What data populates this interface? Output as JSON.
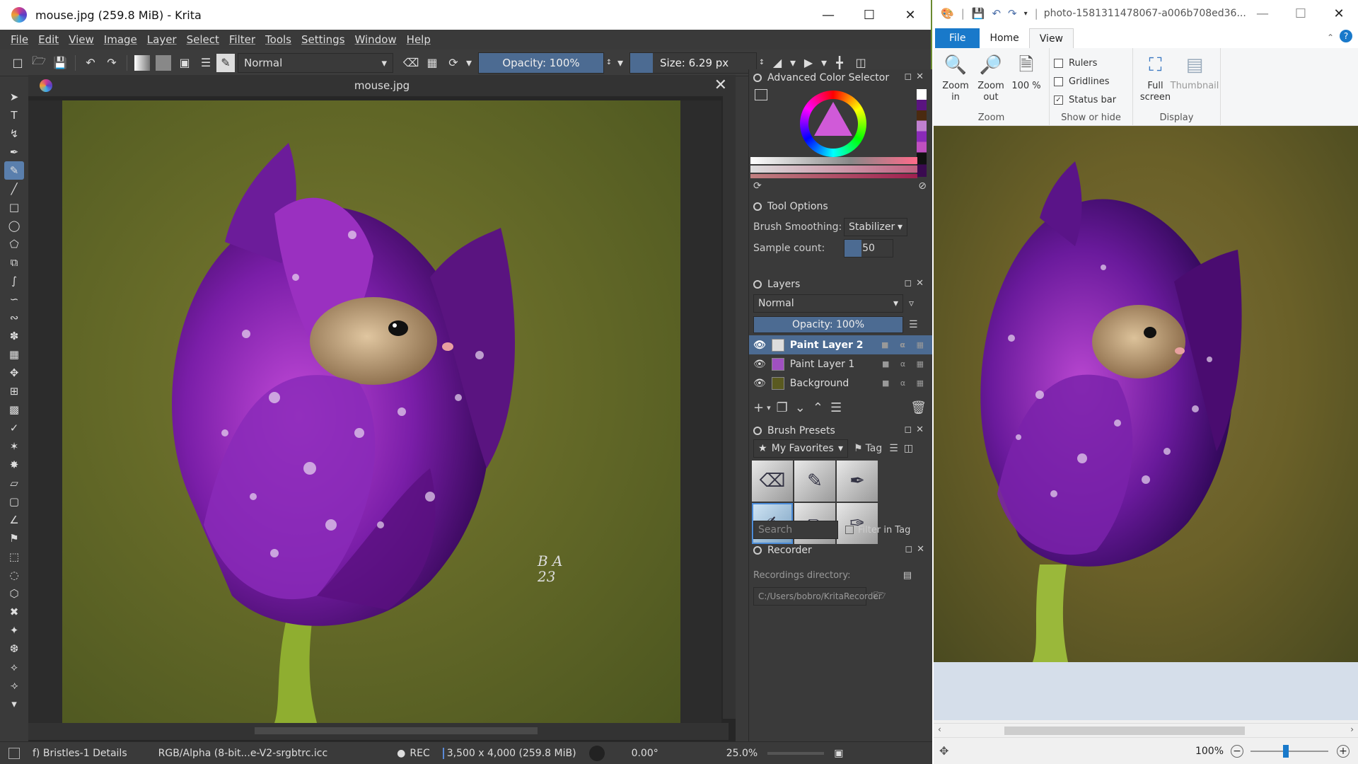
{
  "krita": {
    "window_title": "mouse.jpg (259.8 MiB)  - Krita",
    "menu": [
      "File",
      "Edit",
      "View",
      "Image",
      "Layer",
      "Select",
      "Filter",
      "Tools",
      "Settings",
      "Window",
      "Help"
    ],
    "toolbar": {
      "blend_mode": "Normal",
      "opacity": "Opacity: 100%",
      "size": "Size: 6.29 px"
    },
    "document_tab": "mouse.jpg",
    "canvas_signature": "B A\n23",
    "dockers": {
      "color_selector": {
        "title": "Advanced Color Selector"
      },
      "tool_options": {
        "title": "Tool Options",
        "smoothing_label": "Brush Smoothing:",
        "smoothing_value": "Stabilizer",
        "sample_label": "Sample count:",
        "sample_value": "50"
      },
      "layers": {
        "title": "Layers",
        "blend": "Normal",
        "opacity": "Opacity:  100%",
        "items": [
          {
            "name": "Paint Layer 2",
            "selected": true
          },
          {
            "name": "Paint Layer 1",
            "selected": false
          },
          {
            "name": "Background",
            "selected": false
          }
        ]
      },
      "brush_presets": {
        "title": "Brush Presets",
        "filter": "My Favorites",
        "tag": "Tag",
        "search_placeholder": "Search",
        "filter_in_tag": "Filter in Tag"
      },
      "recorder": {
        "title": "Recorder",
        "dir_label": "Recordings directory:",
        "dir_value": "C:/Users/bobro/KritaRecorder"
      }
    },
    "status": {
      "brush": "f) Bristles-1 Details",
      "color_space": "RGB/Alpha (8-bit...e-V2-srgbtrc.icc",
      "rec": "REC",
      "dimensions": "3,500 x 4,000 (259.8 MiB)",
      "rotation": "0.00°",
      "zoom": "25.0%"
    },
    "colors": {
      "accent": "#4c6b92",
      "bg": "#3a3a3a"
    }
  },
  "paint": {
    "window_title": "photo-1581311478067-a006b708ed36...",
    "tabs": [
      "File",
      "Home",
      "View"
    ],
    "active_tab": "View",
    "ribbon": {
      "zoom_in": "Zoom in",
      "zoom_out": "Zoom out",
      "hundred": "100 %",
      "zoom_group": "Zoom",
      "rulers": "Rulers",
      "gridlines": "Gridlines",
      "status_bar": "Status bar",
      "show_hide_group": "Show or hide",
      "full_screen": "Full screen",
      "thumbnail": "Thumbnail",
      "display_group": "Display"
    },
    "status": {
      "zoom": "100%"
    },
    "colors": {
      "file_tab": "#1979ca"
    }
  }
}
